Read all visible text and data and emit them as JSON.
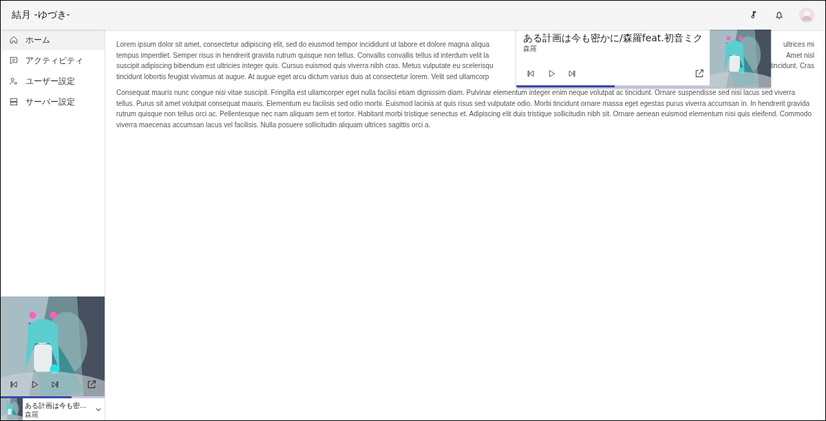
{
  "app_bar": {
    "title": "結月 -ゆづき-"
  },
  "nav": {
    "items": [
      {
        "label": "ホーム",
        "kind": "home",
        "selected": true
      },
      {
        "label": "アクティビティ",
        "kind": "activity",
        "selected": false
      },
      {
        "label": "ユーザー設定",
        "kind": "user",
        "selected": false
      },
      {
        "label": "サーバー設定",
        "kind": "server",
        "selected": false
      }
    ]
  },
  "content": {
    "paragraph_1_lines": [
      {
        "left": "Lorem ipsum dolor sit amet, consectetur adipiscing elit, sed do eiusmod tempor incididunt ut labore et dolore magna aliqua",
        "right": "ultrices mi"
      },
      {
        "left": "tempus imperdiet. Semper risus in hendrerit gravida rutrum quisque non tellus. Convallis convallis tellus id interdum velit la",
        "right": "Amet nisl"
      },
      {
        "left": "suscipit adipiscing bibendum est ultricies integer quis. Cursus euismod quis viverra nibh cras. Metus vulputate eu scelerisqu",
        "right": "tincidunt. Cras"
      },
      {
        "left": "tincidunt lobortis feugiat vivamus at augue. At augue eget arcu dictum varius duis at consectetur lorem. Velit sed ullamcorp"
      }
    ],
    "paragraph_2": "Consequat mauris nunc congue nisi vitae suscipit. Fringilla est ullamcorper eget nulla facilisi etiam dignissim diam. Pulvinar elementum integer enim neque volutpat ac tincidunt. Ornare suspendisse sed nisi lacus sed viverra tellus. Purus sit amet volutpat consequat mauris. Elementum eu facilisis sed odio morbi. Euismod lacinia at quis risus sed vulputate odio. Morbi tincidunt ornare massa eget egestas purus viverra accumsan in. In hendrerit gravida rutrum quisque non tellus orci ac. Pellentesque nec nam aliquam sem et tortor. Habitant morbi tristique senectus et. Adipiscing elit duis tristique sollicitudin nibh sit. Ornare aenean euismod elementum nisi quis eleifend. Commodo viverra maecenas accumsan lacus vel facilisis. Nulla posuere sollicitudin aliquam ultrices sagittis orci a."
  },
  "now_playing_popup": {
    "title": "ある計画は今も密かに/森羅feat.初音ミク",
    "artist": "森羅",
    "level": 0.51
  },
  "sidebar_player": {
    "title": "ある計画は今も密...",
    "artist": "森羅",
    "level": 0.68
  }
}
